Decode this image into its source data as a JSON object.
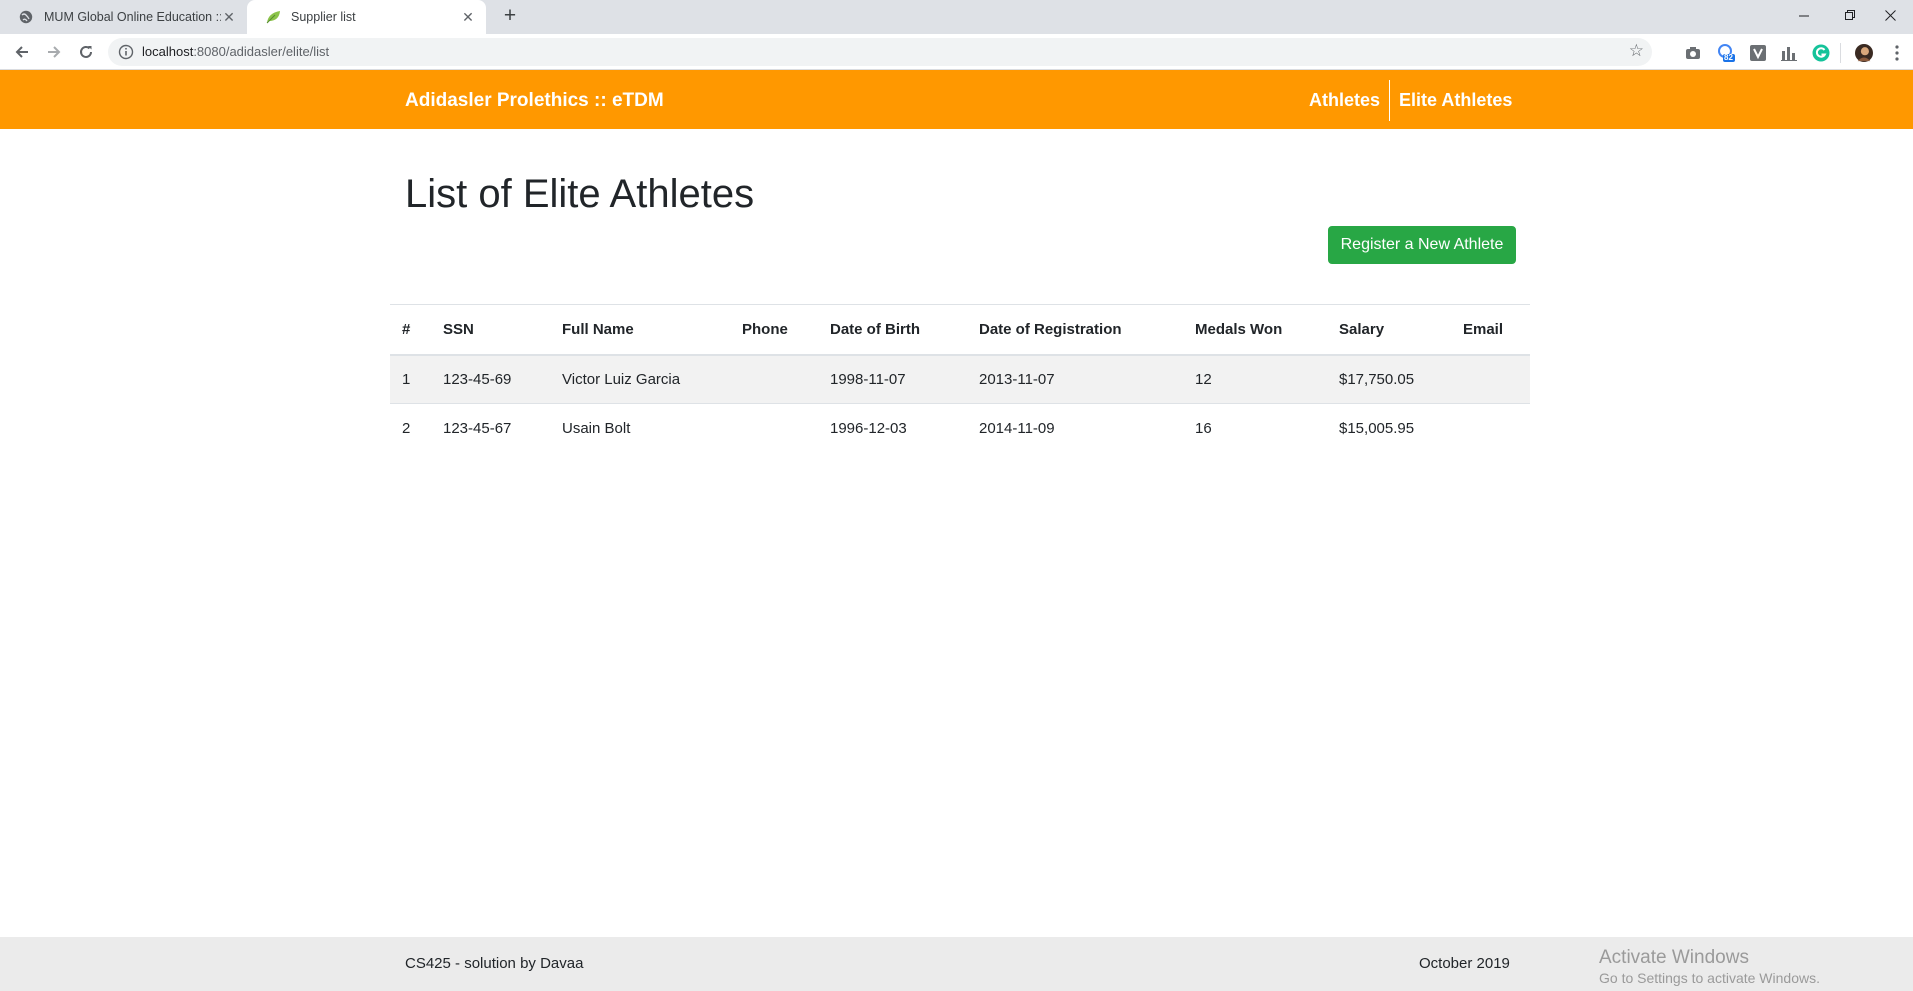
{
  "browser": {
    "tabs": [
      {
        "title": "MUM Global Online Education :: C",
        "icon": "globe-icon"
      },
      {
        "title": "Supplier list",
        "icon": "leaf-icon"
      }
    ],
    "new_tab": "+",
    "url_host": "localhost",
    "url_rest": ":8080/adidasler/elite/list",
    "extension_badge": "82"
  },
  "navbar": {
    "brand": "Adidasler Prolethics :: eTDM",
    "links": [
      "Athletes",
      "Elite Athletes"
    ]
  },
  "main": {
    "title": "List of Elite Athletes",
    "register_button": "Register a New Athlete",
    "table": {
      "columns": [
        "#",
        "SSN",
        "Full Name",
        "Phone",
        "Date of Birth",
        "Date of Registration",
        "Medals Won",
        "Salary",
        "Email"
      ],
      "rows": [
        [
          "1",
          "123-45-69",
          "Victor Luiz Garcia",
          "",
          "1998-11-07",
          "2013-11-07",
          "12",
          "$17,750.05",
          ""
        ],
        [
          "2",
          "123-45-67",
          "Usain Bolt",
          "",
          "1996-12-03",
          "2014-11-09",
          "16",
          "$15,005.95",
          ""
        ]
      ]
    }
  },
  "footer": {
    "left": "CS425 - solution by Davaa",
    "right": "October 2019"
  },
  "watermark": {
    "line1": "Activate Windows",
    "line2": "Go to Settings to activate Windows."
  },
  "colors": {
    "navbar": "#ff9800",
    "button": "#28a745",
    "footer": "#ebebeb"
  }
}
